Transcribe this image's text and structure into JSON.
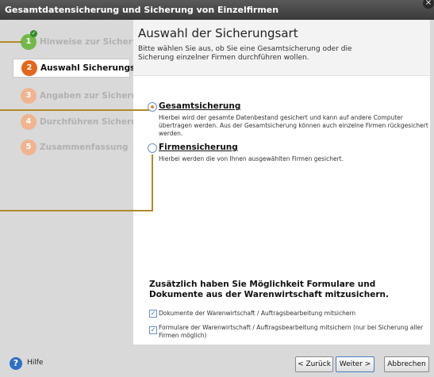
{
  "window": {
    "title": "Gesamtdatensicherung und Sicherung von Einzelfirmen",
    "close_label": "×"
  },
  "sidebar": {
    "steps": [
      {
        "number": "1",
        "label": "Hinweise zur Sicherung",
        "state": "done"
      },
      {
        "number": "2",
        "label": "Auswahl Sicherungsart",
        "state": "active"
      },
      {
        "number": "3",
        "label": "Angaben zur Sicherung",
        "state": "pending"
      },
      {
        "number": "4",
        "label": "Durchführen Sicherung",
        "state": "pending"
      },
      {
        "number": "5",
        "label": "Zusammenfassung",
        "state": "pending"
      }
    ]
  },
  "header": {
    "title": "Auswahl der Sicherungsart",
    "description": "Bitte wählen Sie aus, ob Sie eine Gesamtsicherung oder die Sicherung einzelner Firmen durchführen wollen."
  },
  "options": [
    {
      "title": "Gesamtsicherung",
      "selected": true,
      "description": "Hierbei wird der gesamte Datenbestand gesichert und kann auf andere Computer übertragen werden. Aus der Gesamtsicherung können auch einzelne Firmen rückgesichert werden."
    },
    {
      "title": "Firmensicherung",
      "selected": false,
      "description": "Hierbei werden die von Ihnen ausgewählten Firmen gesichert."
    }
  ],
  "extra": {
    "heading": "Zusätzlich haben Sie Möglichkeit Formulare und Dokumente aus der Warenwirtschaft mitzusichern.",
    "checkboxes": [
      {
        "label": "Dokumente der Warenwirtschaft / Auftragsbearbeitung mitsichern",
        "checked": true
      },
      {
        "label": "Formulare der Warenwirtschaft / Auftragsbearbeitung mitsichern (nur bei Sicherung aller Firmen möglich)",
        "checked": true
      }
    ]
  },
  "footer": {
    "help_label": "Hilfe",
    "back_label": "< Zurück",
    "next_label": "Weiter >",
    "cancel_label": "Abbrechen"
  },
  "colors": {
    "accent_orange": "#e3661d",
    "done_green": "#73b84a",
    "guide_line": "#b08a2a"
  }
}
